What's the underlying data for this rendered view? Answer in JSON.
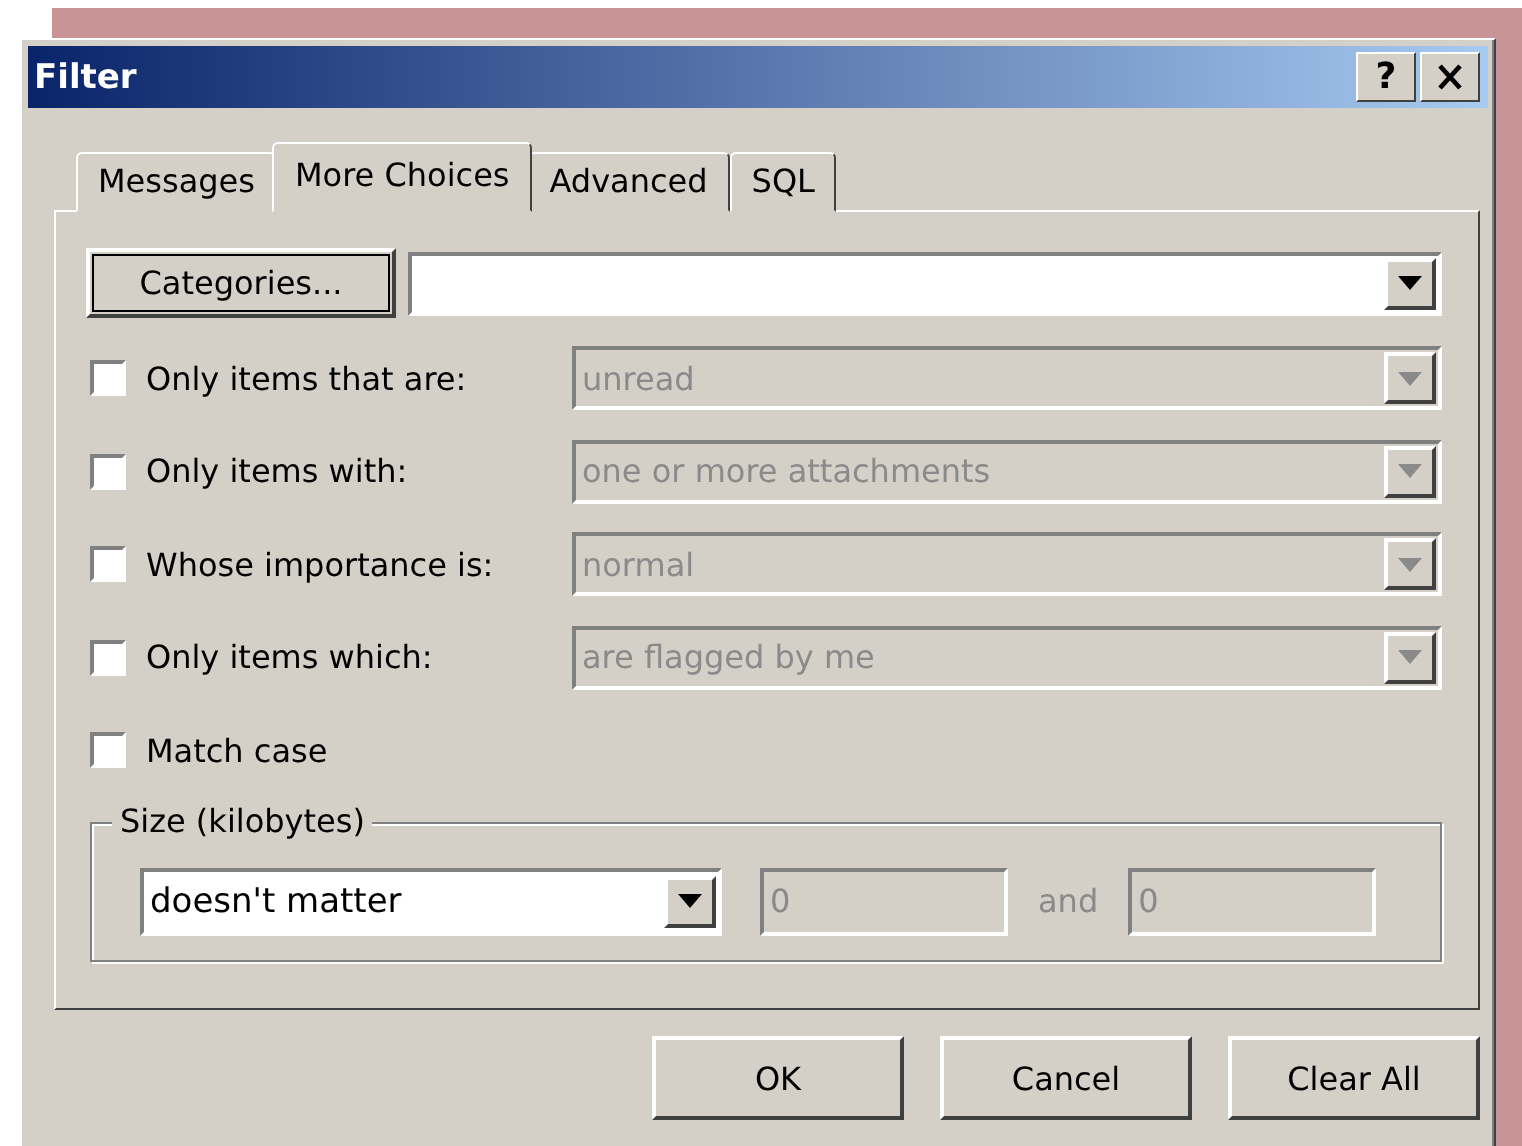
{
  "window": {
    "title": "Filter",
    "help_button": "?"
  },
  "tabs": [
    {
      "label": "Messages",
      "selected": false
    },
    {
      "label": "More Choices",
      "selected": true
    },
    {
      "label": "Advanced",
      "selected": false
    },
    {
      "label": "SQL",
      "selected": false
    }
  ],
  "categories": {
    "button": "Categories..."
  },
  "options": [
    {
      "kind": "combo",
      "label": "Only items that are:",
      "checked": false,
      "value": "unread",
      "disabled": true
    },
    {
      "kind": "combo",
      "label": "Only items with:",
      "checked": false,
      "value": "one or more attachments",
      "disabled": true
    },
    {
      "kind": "combo",
      "label": "Whose importance is:",
      "checked": false,
      "value": "normal",
      "disabled": true
    },
    {
      "kind": "combo",
      "label": "Only items which:",
      "checked": false,
      "value": "are flagged by me",
      "disabled": true
    },
    {
      "kind": "check",
      "label": "Match case",
      "checked": false
    }
  ],
  "size": {
    "legend": "Size (kilobytes)",
    "condition": "doesn't matter",
    "from": "0",
    "between": "and",
    "to": "0",
    "disabled": true
  },
  "buttons": [
    "OK",
    "Cancel",
    "Clear All"
  ]
}
